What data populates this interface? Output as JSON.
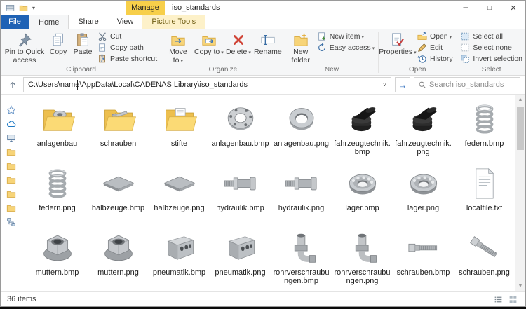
{
  "titlebar": {
    "manage_label": "Manage",
    "title": "iso_standards"
  },
  "tabs": {
    "file": "File",
    "home": "Home",
    "share": "Share",
    "view": "View",
    "picture_tools": "Picture Tools"
  },
  "ribbon": {
    "pin": "Pin to Quick access",
    "copy": "Copy",
    "paste": "Paste",
    "cut": "Cut",
    "copy_path": "Copy path",
    "paste_shortcut": "Paste shortcut",
    "clipboard_group": "Clipboard",
    "move_to": "Move to",
    "copy_to": "Copy to",
    "delete": "Delete",
    "rename": "Rename",
    "organize_group": "Organize",
    "new_folder": "New folder",
    "new_item": "New item",
    "easy_access": "Easy access",
    "new_group": "New",
    "properties": "Properties",
    "open": "Open",
    "edit": "Edit",
    "history": "History",
    "open_group": "Open",
    "select_all": "Select all",
    "select_none": "Select none",
    "invert_selection": "Invert selection",
    "select_group": "Select"
  },
  "address_bar": {
    "path": "C:\\Users\\name\\AppData\\Local\\CADENAS Library\\iso_standards",
    "search_placeholder": "Search iso_standards"
  },
  "sidebar": {
    "items": [
      "star",
      "cloud",
      "pc",
      "folder",
      "folder",
      "folder",
      "folder",
      "folder",
      "network"
    ]
  },
  "files": [
    {
      "label": "anlagenbau",
      "icon": "folder-ring"
    },
    {
      "label": "schrauben",
      "icon": "folder-screw"
    },
    {
      "label": "stifte",
      "icon": "folder-paper"
    },
    {
      "label": "anlagenbau.bmp",
      "icon": "flange"
    },
    {
      "label": "anlagenbau.png",
      "icon": "ring"
    },
    {
      "label": "fahrzeugtechnik.bmp",
      "icon": "cap"
    },
    {
      "label": "fahrzeugtechnik.png",
      "icon": "cap"
    },
    {
      "label": "federn.bmp",
      "icon": "spring"
    },
    {
      "label": "federn.png",
      "icon": "spring"
    },
    {
      "label": "halbzeuge.bmp",
      "icon": "sheet"
    },
    {
      "label": "halbzeuge.png",
      "icon": "sheet"
    },
    {
      "label": "hydraulik.bmp",
      "icon": "fitting"
    },
    {
      "label": "hydraulik.png",
      "icon": "fitting"
    },
    {
      "label": "lager.bmp",
      "icon": "bearing"
    },
    {
      "label": "lager.png",
      "icon": "bearing"
    },
    {
      "label": "localfile.txt",
      "icon": "textfile"
    },
    {
      "label": "muttern.bmp",
      "icon": "nut"
    },
    {
      "label": "muttern.png",
      "icon": "nut"
    },
    {
      "label": "pneumatik.bmp",
      "icon": "block"
    },
    {
      "label": "pneumatik.png",
      "icon": "block"
    },
    {
      "label": "rohrverschraubungen.bmp",
      "icon": "elbow"
    },
    {
      "label": "rohrverschraubungen.png",
      "icon": "elbow"
    },
    {
      "label": "schrauben.bmp",
      "icon": "bolt"
    },
    {
      "label": "schrauben.png",
      "icon": "bolt-diag"
    }
  ],
  "statusbar": {
    "items_count": "36 items"
  },
  "icons": {
    "caret": "▾",
    "minimize": "─",
    "maximize": "□",
    "close": "✕",
    "go": "→",
    "scroll_up": "▲",
    "scroll_down": "▼",
    "chevron_down": "˅"
  },
  "colors": {
    "file_tab_blue": "#1f62b5",
    "manage_gold": "#f7cf4a",
    "contextual_tab_bg": "#fdf1c9",
    "folder_yellow": "#f7d478",
    "delete_red": "#d04437"
  }
}
